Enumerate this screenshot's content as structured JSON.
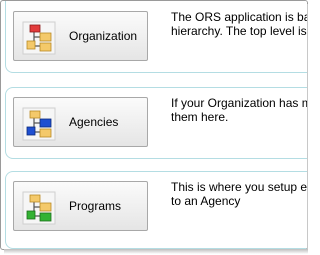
{
  "items": [
    {
      "label": "Organization",
      "icon": "organization-hierarchy-icon",
      "desc_line1": "The ORS application is ba",
      "desc_line2": "hierarchy. The top level is"
    },
    {
      "label": "Agencies",
      "icon": "agencies-hierarchy-icon",
      "desc_line1": "If your Organization has m",
      "desc_line2": "them here."
    },
    {
      "label": "Programs",
      "icon": "programs-hierarchy-icon",
      "desc_line1": "This is where you setup e",
      "desc_line2": "to an Agency"
    }
  ],
  "colors": {
    "panel_border": "#b4dde3",
    "folder": "#f4c96a",
    "org_node": "#e23b3b",
    "agency_node": "#1f4fd1",
    "program_node": "#33b233"
  }
}
